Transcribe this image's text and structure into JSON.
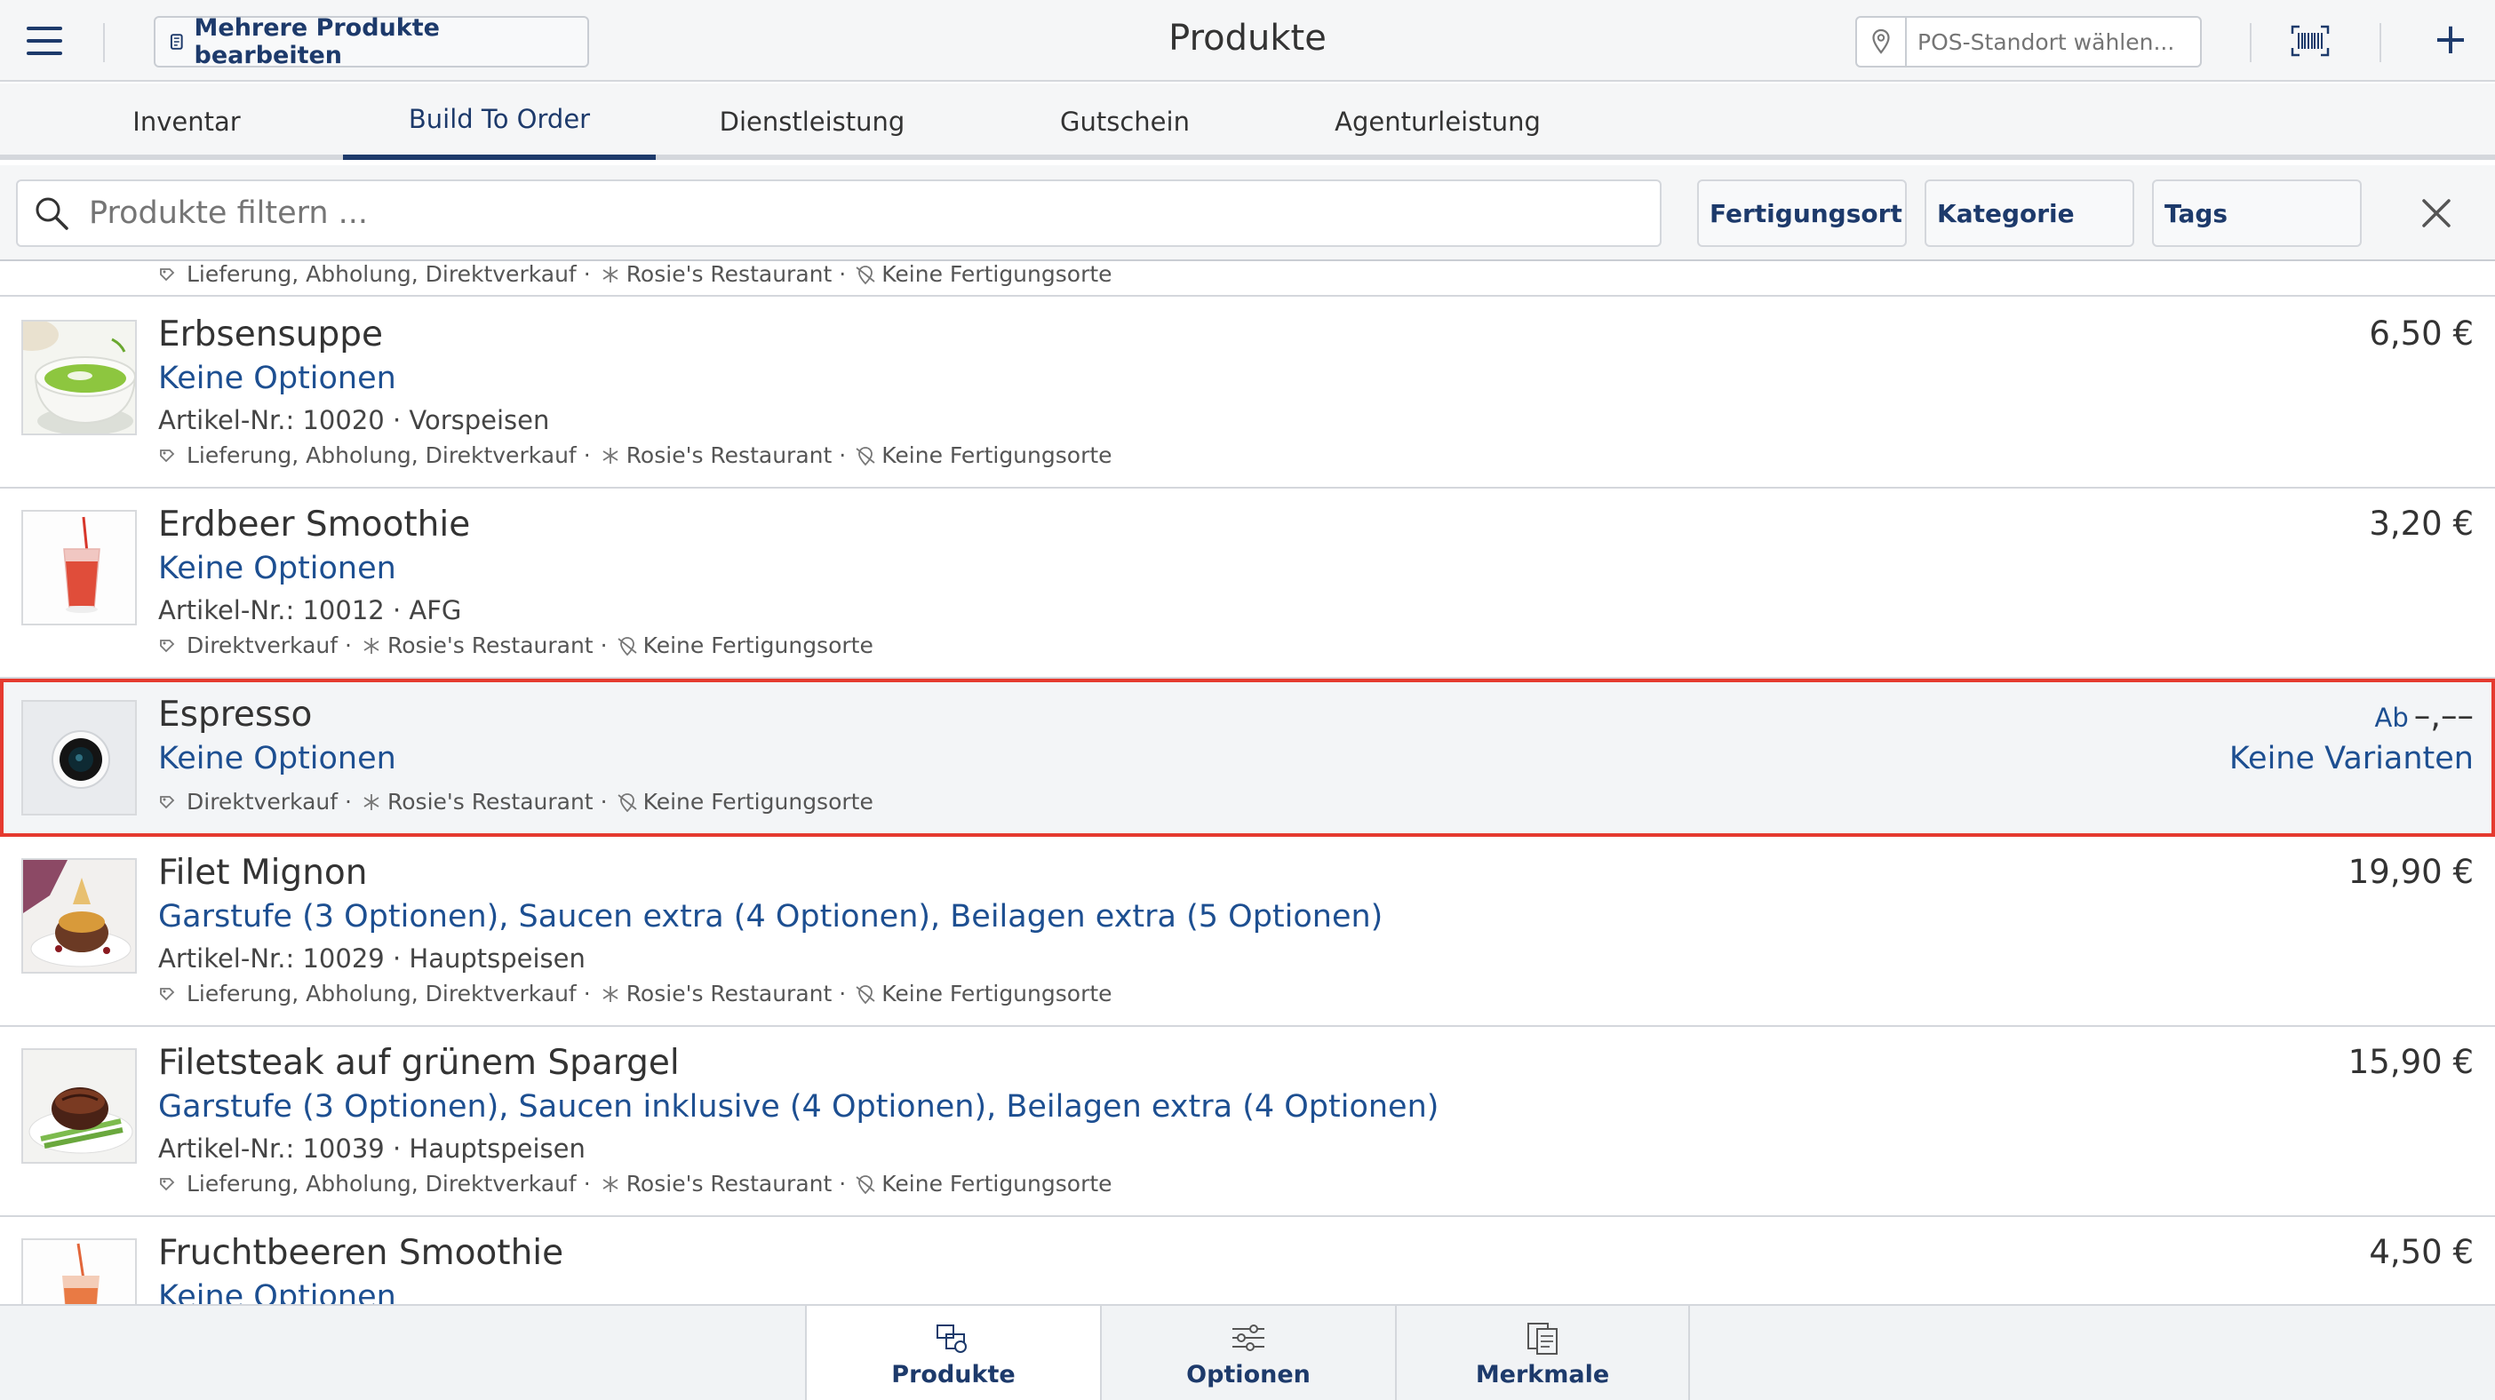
{
  "header": {
    "bulk_edit_label": "Mehrere Produkte bearbeiten",
    "title": "Produkte",
    "pos_placeholder": "POS-Standort wählen...",
    "add_label": "+"
  },
  "tabs": [
    {
      "label": "Inventar"
    },
    {
      "label": "Build To Order",
      "active": true
    },
    {
      "label": "Dienstleistung"
    },
    {
      "label": "Gutschein"
    },
    {
      "label": "Agenturleistung"
    }
  ],
  "filter": {
    "search_placeholder": "Produkte filtern ...",
    "buttons": [
      "Fertigungsort",
      "Kategorie",
      "Tags"
    ]
  },
  "partial_row": {
    "tags": [
      "Lieferung, Abholung, Direktverkauf",
      "Rosie's Restaurant",
      "Keine Fertigungsorte"
    ]
  },
  "products": [
    {
      "name": "Erbsensuppe",
      "options": "Keine Optionen",
      "meta": "Artikel-Nr.: 10020 · Vorspeisen",
      "channels": "Lieferung, Abholung, Direktverkauf",
      "location": "Rosie's Restaurant",
      "production": "Keine Fertigungsorte",
      "price": "6,50 €"
    },
    {
      "name": "Erdbeer Smoothie",
      "options": "Keine Optionen",
      "meta": "Artikel-Nr.: 10012 · AFG",
      "channels": "Direktverkauf",
      "location": "Rosie's Restaurant",
      "production": "Keine Fertigungsorte",
      "price": "3,20 €"
    },
    {
      "name": "Espresso",
      "options": "Keine Optionen",
      "channels": "Direktverkauf",
      "location": "Rosie's Restaurant",
      "production": "Keine Fertigungsorte",
      "price_prefix": "Ab",
      "price": "–,––",
      "variants": "Keine Varianten"
    },
    {
      "name": "Filet Mignon",
      "options": "Garstufe (3 Optionen), Saucen extra (4 Optionen), Beilagen extra (5 Optionen)",
      "meta": "Artikel-Nr.: 10029 · Hauptspeisen",
      "channels": "Lieferung, Abholung, Direktverkauf",
      "location": "Rosie's Restaurant",
      "production": "Keine Fertigungsorte",
      "price": "19,90 €"
    },
    {
      "name": "Filetsteak auf grünem Spargel",
      "options": "Garstufe (3 Optionen), Saucen inklusive (4 Optionen), Beilagen extra (4 Optionen)",
      "meta": "Artikel-Nr.: 10039 · Hauptspeisen",
      "channels": "Lieferung, Abholung, Direktverkauf",
      "location": "Rosie's Restaurant",
      "production": "Keine Fertigungsorte",
      "price": "15,90 €"
    },
    {
      "name": "Fruchtbeeren Smoothie",
      "options": "Keine Optionen",
      "price": "4,50 €"
    }
  ],
  "bottom_nav": [
    {
      "label": "Produkte",
      "icon": "boxes-icon",
      "active": true
    },
    {
      "label": "Optionen",
      "icon": "sliders-icon"
    },
    {
      "label": "Merkmale",
      "icon": "clipboard-icon"
    }
  ],
  "colors": {
    "accent": "#1d3a6b",
    "link": "#1d4f91",
    "selection_border": "#e53a2f"
  }
}
